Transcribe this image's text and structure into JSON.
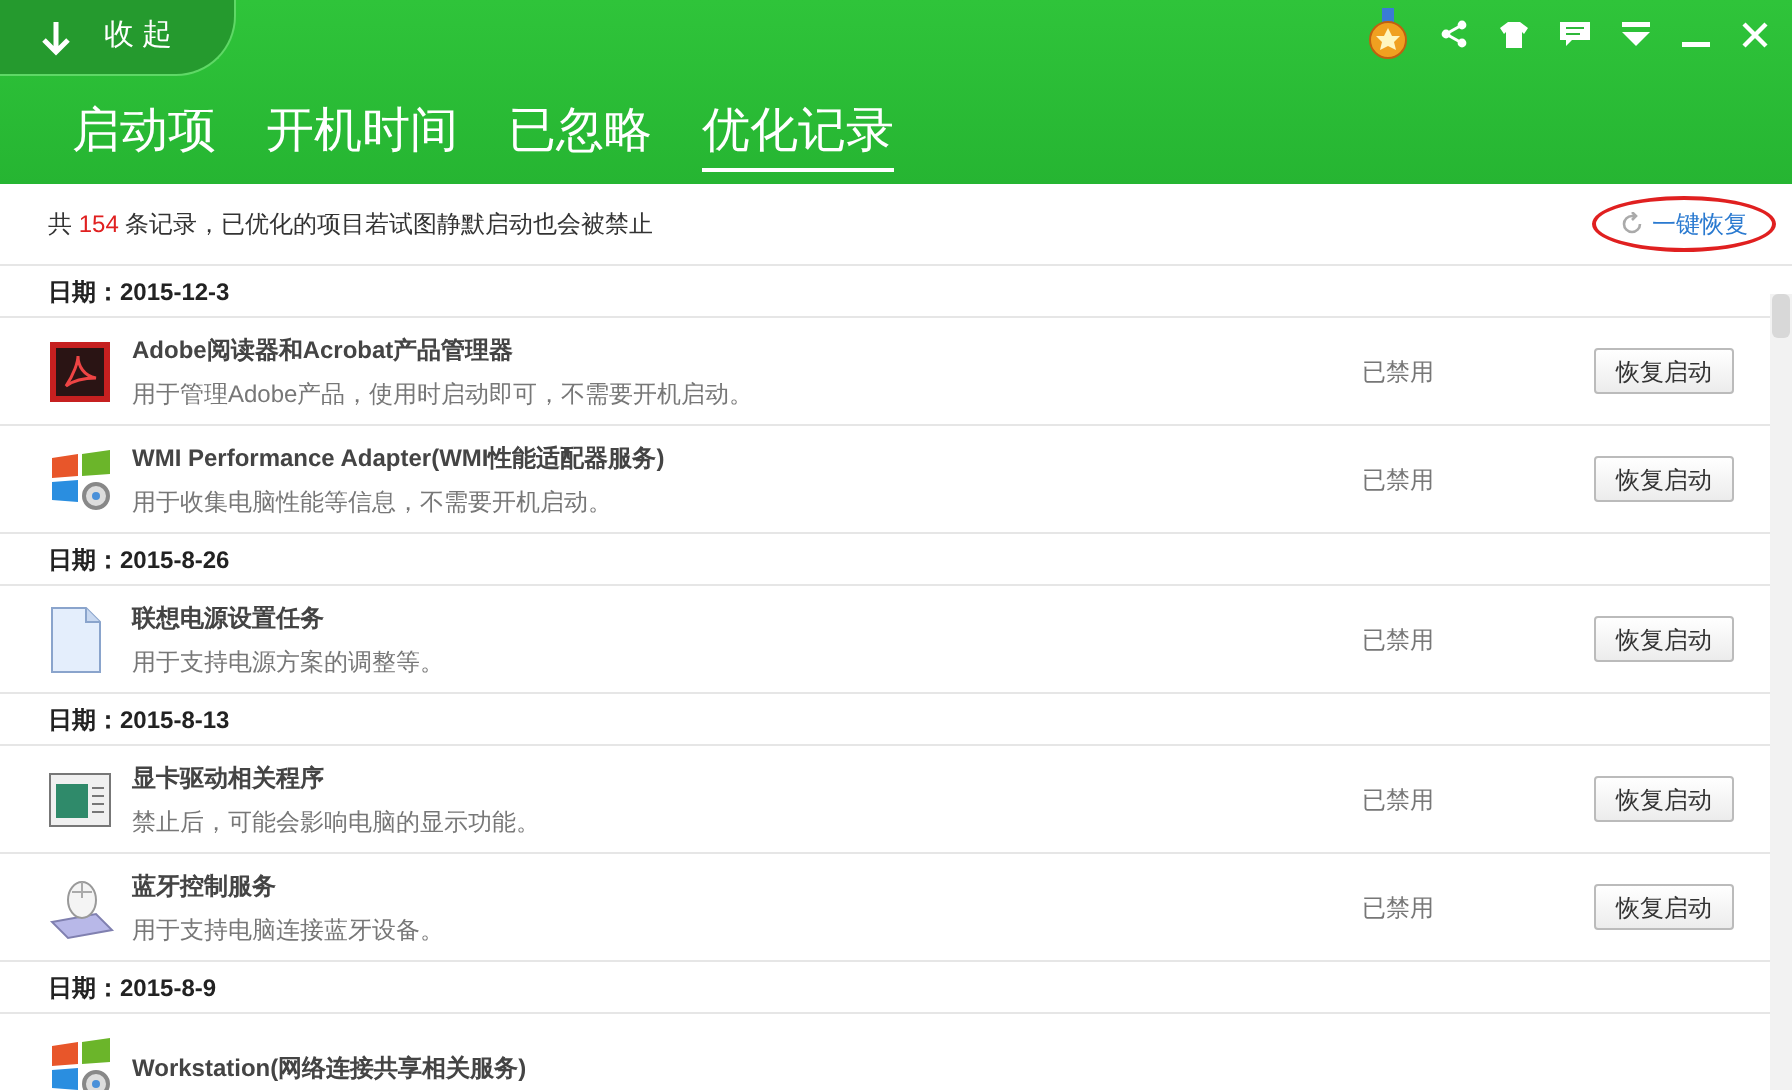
{
  "collapse_button": {
    "label": "收 起"
  },
  "tabs": [
    {
      "label": "启动项",
      "selected": false
    },
    {
      "label": "开机时间",
      "selected": false
    },
    {
      "label": "已忽略",
      "selected": false
    },
    {
      "label": "优化记录",
      "selected": true
    }
  ],
  "summary": {
    "prefix": "共",
    "count": "154",
    "suffix": "条记录，已优化的项目若试图静默启动也会被禁止"
  },
  "restore_all_link": {
    "label": "一键恢复",
    "circled": true
  },
  "groups": [
    {
      "date_label": "日期：2015-12-3",
      "items": [
        {
          "kind": "pdf",
          "title": "Adobe阅读器和Acrobat产品管理器",
          "description": "用于管理Adobe产品，使用时启动即可，不需要开机启动。",
          "status": "已禁用",
          "button": "恢复启动"
        },
        {
          "kind": "windows",
          "title": "WMI Performance Adapter(WMI性能适配器服务)",
          "description": "用于收集电脑性能等信息，不需要开机启动。",
          "status": "已禁用",
          "button": "恢复启动"
        }
      ]
    },
    {
      "date_label": "日期：2015-8-26",
      "items": [
        {
          "kind": "document",
          "title": "联想电源设置任务",
          "description": "用于支持电源方案的调整等。",
          "status": "已禁用",
          "button": "恢复启动"
        }
      ]
    },
    {
      "date_label": "日期：2015-8-13",
      "items": [
        {
          "kind": "display",
          "title": "显卡驱动相关程序",
          "description": "禁止后，可能会影响电脑的显示功能。",
          "status": "已禁用",
          "button": "恢复启动"
        },
        {
          "kind": "mouse",
          "title": "蓝牙控制服务",
          "description": "用于支持电脑连接蓝牙设备。",
          "status": "已禁用",
          "button": "恢复启动"
        }
      ]
    },
    {
      "date_label": "日期：2015-8-9",
      "items": [
        {
          "kind": "windows",
          "title": "Workstation(网络连接共享相关服务)"
        }
      ]
    }
  ]
}
